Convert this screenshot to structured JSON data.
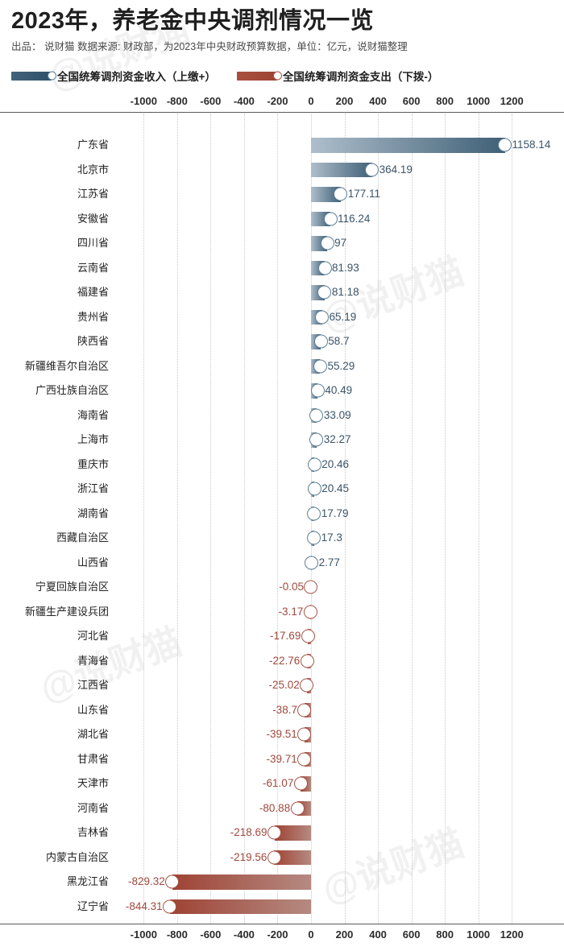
{
  "header": {
    "title": "2023年，养老金中央调剂情况一览",
    "subtitle": "出品： 说财猫  数据来源: 财政部，为2023年中央财政预算数据，单位：亿元，说财猫整理"
  },
  "legend": {
    "items": [
      {
        "label": "全国统筹调剂资金收入（上缴+）",
        "color": "#3f6076"
      },
      {
        "label": "全国统筹调剂资金支出（下拨-）",
        "color": "#9e4334"
      }
    ]
  },
  "watermark": {
    "text": "@说财猫"
  },
  "chart_data": {
    "type": "bar",
    "orientation": "horizontal",
    "title": "2023年，养老金中央调剂情况一览",
    "subtitle": "出品： 说财猫  数据来源: 财政部，为2023年中央财政预算数据，单位：亿元，说财猫整理",
    "xlabel": "",
    "ylabel": "",
    "unit": "亿元",
    "xlim": [
      -1100,
      1300
    ],
    "xticks": [
      -1000,
      -800,
      -600,
      -400,
      -200,
      0,
      200,
      400,
      600,
      800,
      1000,
      1200
    ],
    "xtick_labels": [
      "-1000",
      "-800",
      "-600",
      "-400",
      "-200",
      "0",
      "200",
      "400",
      "600",
      "800",
      "1000",
      "1200"
    ],
    "grid": true,
    "legend_position": "top-left",
    "series": [
      {
        "name": "全国统筹调剂资金收入（上缴+）",
        "color": "#3f6076"
      },
      {
        "name": "全国统筹调剂资金支出（下拨-）",
        "color": "#9e4334"
      }
    ],
    "categories": [
      "广东省",
      "北京市",
      "江苏省",
      "安徽省",
      "四川省",
      "云南省",
      "福建省",
      "贵州省",
      "陕西省",
      "新疆维吾尔自治区",
      "广西壮族自治区",
      "海南省",
      "上海市",
      "重庆市",
      "浙江省",
      "湖南省",
      "西藏自治区",
      "山西省",
      "宁夏回族自治区",
      "新疆生产建设兵团",
      "河北省",
      "青海省",
      "江西省",
      "山东省",
      "湖北省",
      "甘肃省",
      "天津市",
      "河南省",
      "吉林省",
      "内蒙古自治区",
      "黑龙江省",
      "辽宁省"
    ],
    "values": [
      1158.14,
      364.19,
      177.11,
      116.24,
      97,
      81.93,
      81.18,
      65.19,
      58.7,
      55.29,
      40.49,
      33.09,
      32.27,
      20.46,
      20.45,
      17.79,
      17.3,
      2.77,
      -0.05,
      -3.17,
      -17.69,
      -22.76,
      -25.02,
      -38.7,
      -39.51,
      -39.71,
      -61.07,
      -80.88,
      -218.69,
      -219.56,
      -829.32,
      -844.31
    ],
    "value_labels": [
      "1158.14",
      "364.19",
      "177.11",
      "116.24",
      "97",
      "81.93",
      "81.18",
      "65.19",
      "58.7",
      "55.29",
      "40.49",
      "33.09",
      "32.27",
      "20.46",
      "20.45",
      "17.79",
      "17.3",
      "2.77",
      "-0.05",
      "-3.17",
      "-17.69",
      "-22.76",
      "-25.02",
      "-38.7",
      "-39.51",
      "-39.71",
      "-61.07",
      "-80.88",
      "-218.69",
      "-219.56",
      "-829.32",
      "-844.31"
    ]
  }
}
